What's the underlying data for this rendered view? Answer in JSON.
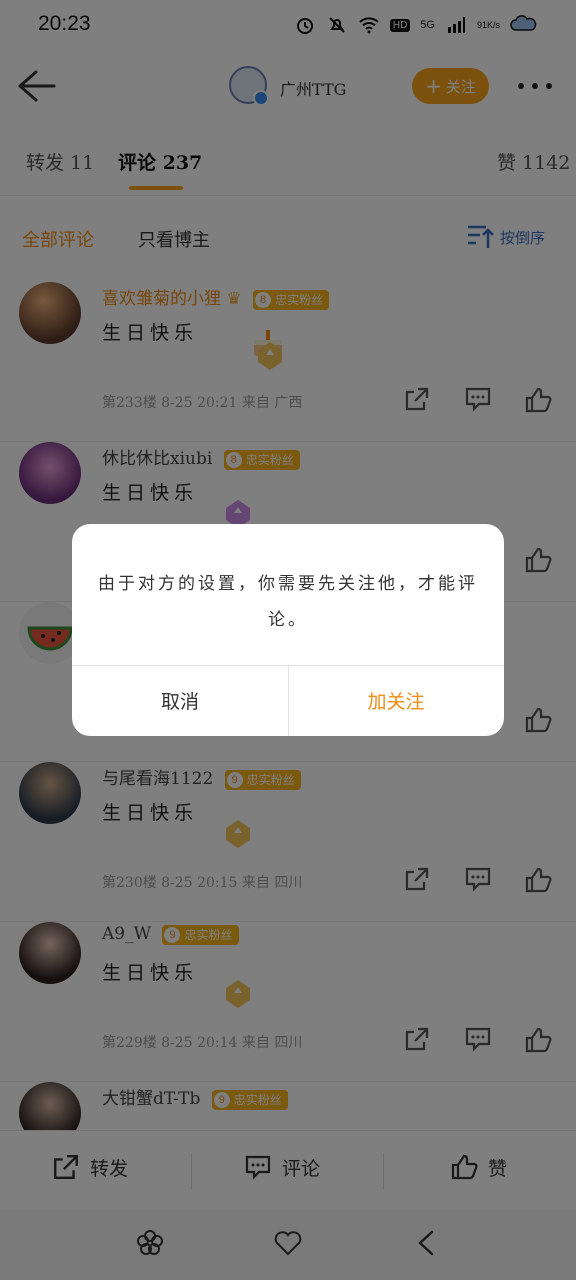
{
  "status_bar": {
    "time": "20:23",
    "network": "5G",
    "hd": "HD",
    "speed": "91K/s",
    "icons": [
      "alarm-icon",
      "mute-bell-icon",
      "wifi-icon",
      "hd-icon",
      "signal-icon",
      "battery-icon"
    ]
  },
  "top_nav": {
    "user_name": "广州TTG",
    "follow_label": "关注",
    "follow_plus": "+"
  },
  "tabs": [
    {
      "label": "转发 11"
    },
    {
      "label": "评论 237",
      "active": true
    },
    {
      "label": "赞 1142"
    }
  ],
  "filter": {
    "all": "全部评论",
    "author_only": "只看博主",
    "sort": "按倒序"
  },
  "comments": [
    {
      "user": "喜欢雏菊的小狸",
      "level": "8",
      "badge": "忠实粉丝",
      "text": "生日快乐",
      "meta": "第233楼  8-25 20:21  来自 广西",
      "vip": true
    },
    {
      "user": "休比休比xiubi",
      "level": "8",
      "badge": "忠实粉丝",
      "text": "生日快乐",
      "meta": "",
      "vip": false
    },
    {
      "user": "",
      "level": "",
      "badge": "",
      "text": "",
      "meta": "",
      "vip": false
    },
    {
      "user": "与尾看海1122",
      "level": "9",
      "badge": "忠实粉丝",
      "text": "生日快乐",
      "meta": "第230楼  8-25 20:15  来自 四川",
      "vip": false
    },
    {
      "user": "A9_W",
      "level": "9",
      "badge": "忠实粉丝",
      "text": "生日快乐",
      "meta": "第229楼  8-25 20:14  来自 四川",
      "vip": false
    },
    {
      "user": "大钳蟹dT-Tb",
      "level": "9",
      "badge": "忠实粉丝",
      "text": "",
      "meta": "",
      "vip": false
    }
  ],
  "dialog": {
    "message": "由于对方的设置，你需要先关注他，才能评论。",
    "cancel": "取消",
    "confirm": "加关注"
  },
  "bottom_bar": {
    "repost": "转发",
    "comment": "评论",
    "like": "赞"
  },
  "colors": {
    "accent": "#f7a21b",
    "accent_text": "#f08c14",
    "link": "#3a6dbf",
    "overlay": "rgba(0,0,0,0.5)"
  }
}
